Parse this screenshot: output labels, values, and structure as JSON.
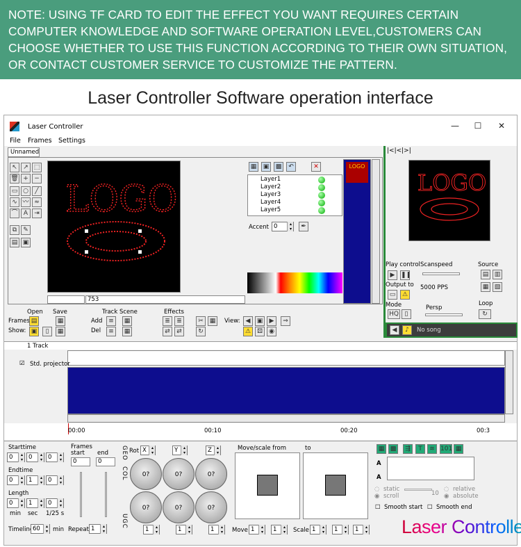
{
  "banner": {
    "text": "NOTE: USING TF CARD TO EDIT THE EFFECT YOU WANT REQUIRES CERTAIN COMPUTER KNOWLEDGE AND SOFTWARE OPERATION LEVEL,CUSTOMERS CAN CHOOSE WHETHER TO USE THIS FUNCTION ACCORDING TO THEIR OWN SITUATION, OR CONTACT CUSTOMER SERVICE TO CUSTOMIZE THE PATTERN."
  },
  "heading": "Laser Controller Software operation interface",
  "window": {
    "title": "Laser Controller",
    "minimize": "—",
    "maximize": "☐",
    "close": "✕"
  },
  "menu": [
    "File",
    "Frames",
    "Settings"
  ],
  "tab": "Unnamed",
  "canvas": {
    "logo_text": "LOGO",
    "frame_number": "753"
  },
  "layers": {
    "items": [
      "Layer1",
      "Layer2",
      "Layer3",
      "Layer4",
      "Layer5"
    ],
    "accent_label": "Accent",
    "accent_value": "0"
  },
  "preview": {
    "logo_text": "LOGO",
    "thumb_text": "LOGO"
  },
  "play": {
    "play_control": "Play control",
    "scanspeed": "Scanspeed",
    "source": "Source",
    "output_to": "Output to",
    "pps": "5000 PPS",
    "mode": "Mode",
    "persp": "Persp",
    "loop": "Loop",
    "hq": "HQ",
    "song": "No song"
  },
  "toolbar2": {
    "open": "Open",
    "save": "Save",
    "frames": "Frames:",
    "show": "Show:",
    "track_scene": "Track Scene",
    "add": "Add",
    "del": "Del",
    "effects": "Effects",
    "view": "View:"
  },
  "timeline": {
    "tracks": "1 Track",
    "projector": "Std. projector",
    "times": [
      "00:00",
      "00:10",
      "00:20",
      "00:3"
    ]
  },
  "bottom": {
    "starttime": "Starttime",
    "endtime": "Endtime",
    "length": "Length",
    "min": "min",
    "sec": "sec",
    "fps": "1/25 s",
    "timeline": "Timeline",
    "timeline_value": "60",
    "timeline_unit": "min",
    "frames": "Frames",
    "start": "start",
    "end": "end",
    "frames_start": "0",
    "frames_end": "0",
    "repeat": "Repeat",
    "repeat_value": "1",
    "geo": "GEO",
    "col": "COL",
    "ugc": "UGC",
    "rot": "Rot",
    "axis_x": "X",
    "axis_y": "Y",
    "axis_z": "Z",
    "knob_value": "0?",
    "move_scale_from": "Move/scale from",
    "to": "to",
    "move": "Move",
    "scale": "Scale",
    "static": "static",
    "scroll": "scroll",
    "relative": "relative",
    "absolute": "absolute",
    "smooth_start": "Smooth start",
    "smooth_end": "Smooth end",
    "ten": "10",
    "zero": "0",
    "one": "1",
    "btn_101": "101"
  },
  "watermark": "Laser Controller"
}
